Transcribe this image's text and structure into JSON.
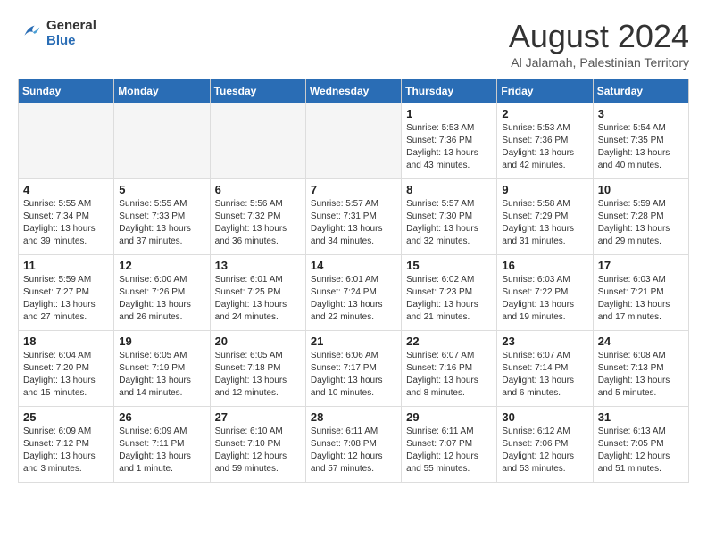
{
  "logo": {
    "line1": "General",
    "line2": "Blue"
  },
  "header": {
    "month": "August 2024",
    "location": "Al Jalamah, Palestinian Territory"
  },
  "weekdays": [
    "Sunday",
    "Monday",
    "Tuesday",
    "Wednesday",
    "Thursday",
    "Friday",
    "Saturday"
  ],
  "weeks": [
    [
      {
        "day": "",
        "info": ""
      },
      {
        "day": "",
        "info": ""
      },
      {
        "day": "",
        "info": ""
      },
      {
        "day": "",
        "info": ""
      },
      {
        "day": "1",
        "info": "Sunrise: 5:53 AM\nSunset: 7:36 PM\nDaylight: 13 hours\nand 43 minutes."
      },
      {
        "day": "2",
        "info": "Sunrise: 5:53 AM\nSunset: 7:36 PM\nDaylight: 13 hours\nand 42 minutes."
      },
      {
        "day": "3",
        "info": "Sunrise: 5:54 AM\nSunset: 7:35 PM\nDaylight: 13 hours\nand 40 minutes."
      }
    ],
    [
      {
        "day": "4",
        "info": "Sunrise: 5:55 AM\nSunset: 7:34 PM\nDaylight: 13 hours\nand 39 minutes."
      },
      {
        "day": "5",
        "info": "Sunrise: 5:55 AM\nSunset: 7:33 PM\nDaylight: 13 hours\nand 37 minutes."
      },
      {
        "day": "6",
        "info": "Sunrise: 5:56 AM\nSunset: 7:32 PM\nDaylight: 13 hours\nand 36 minutes."
      },
      {
        "day": "7",
        "info": "Sunrise: 5:57 AM\nSunset: 7:31 PM\nDaylight: 13 hours\nand 34 minutes."
      },
      {
        "day": "8",
        "info": "Sunrise: 5:57 AM\nSunset: 7:30 PM\nDaylight: 13 hours\nand 32 minutes."
      },
      {
        "day": "9",
        "info": "Sunrise: 5:58 AM\nSunset: 7:29 PM\nDaylight: 13 hours\nand 31 minutes."
      },
      {
        "day": "10",
        "info": "Sunrise: 5:59 AM\nSunset: 7:28 PM\nDaylight: 13 hours\nand 29 minutes."
      }
    ],
    [
      {
        "day": "11",
        "info": "Sunrise: 5:59 AM\nSunset: 7:27 PM\nDaylight: 13 hours\nand 27 minutes."
      },
      {
        "day": "12",
        "info": "Sunrise: 6:00 AM\nSunset: 7:26 PM\nDaylight: 13 hours\nand 26 minutes."
      },
      {
        "day": "13",
        "info": "Sunrise: 6:01 AM\nSunset: 7:25 PM\nDaylight: 13 hours\nand 24 minutes."
      },
      {
        "day": "14",
        "info": "Sunrise: 6:01 AM\nSunset: 7:24 PM\nDaylight: 13 hours\nand 22 minutes."
      },
      {
        "day": "15",
        "info": "Sunrise: 6:02 AM\nSunset: 7:23 PM\nDaylight: 13 hours\nand 21 minutes."
      },
      {
        "day": "16",
        "info": "Sunrise: 6:03 AM\nSunset: 7:22 PM\nDaylight: 13 hours\nand 19 minutes."
      },
      {
        "day": "17",
        "info": "Sunrise: 6:03 AM\nSunset: 7:21 PM\nDaylight: 13 hours\nand 17 minutes."
      }
    ],
    [
      {
        "day": "18",
        "info": "Sunrise: 6:04 AM\nSunset: 7:20 PM\nDaylight: 13 hours\nand 15 minutes."
      },
      {
        "day": "19",
        "info": "Sunrise: 6:05 AM\nSunset: 7:19 PM\nDaylight: 13 hours\nand 14 minutes."
      },
      {
        "day": "20",
        "info": "Sunrise: 6:05 AM\nSunset: 7:18 PM\nDaylight: 13 hours\nand 12 minutes."
      },
      {
        "day": "21",
        "info": "Sunrise: 6:06 AM\nSunset: 7:17 PM\nDaylight: 13 hours\nand 10 minutes."
      },
      {
        "day": "22",
        "info": "Sunrise: 6:07 AM\nSunset: 7:16 PM\nDaylight: 13 hours\nand 8 minutes."
      },
      {
        "day": "23",
        "info": "Sunrise: 6:07 AM\nSunset: 7:14 PM\nDaylight: 13 hours\nand 6 minutes."
      },
      {
        "day": "24",
        "info": "Sunrise: 6:08 AM\nSunset: 7:13 PM\nDaylight: 13 hours\nand 5 minutes."
      }
    ],
    [
      {
        "day": "25",
        "info": "Sunrise: 6:09 AM\nSunset: 7:12 PM\nDaylight: 13 hours\nand 3 minutes."
      },
      {
        "day": "26",
        "info": "Sunrise: 6:09 AM\nSunset: 7:11 PM\nDaylight: 13 hours\nand 1 minute."
      },
      {
        "day": "27",
        "info": "Sunrise: 6:10 AM\nSunset: 7:10 PM\nDaylight: 12 hours\nand 59 minutes."
      },
      {
        "day": "28",
        "info": "Sunrise: 6:11 AM\nSunset: 7:08 PM\nDaylight: 12 hours\nand 57 minutes."
      },
      {
        "day": "29",
        "info": "Sunrise: 6:11 AM\nSunset: 7:07 PM\nDaylight: 12 hours\nand 55 minutes."
      },
      {
        "day": "30",
        "info": "Sunrise: 6:12 AM\nSunset: 7:06 PM\nDaylight: 12 hours\nand 53 minutes."
      },
      {
        "day": "31",
        "info": "Sunrise: 6:13 AM\nSunset: 7:05 PM\nDaylight: 12 hours\nand 51 minutes."
      }
    ]
  ]
}
